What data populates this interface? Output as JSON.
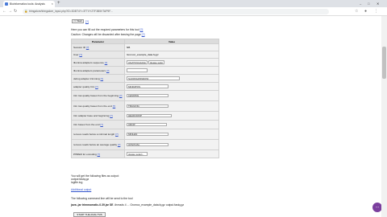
{
  "browser": {
    "tab_title": "Bioinformatics tools: Analysis",
    "url": "trimgalore/trimgalore_input.php?ID=3DBT4Y=3TTXYZ7F3B5VTAP9F...",
    "window_buttons": [
      "–",
      "□",
      "✕"
    ]
  },
  "page": {
    "start_button": "<< Start",
    "intro": "Here you can fill out the required parameters for this tool",
    "caution": "Caution: Changes will be discarded after leaving the page",
    "help_mark": "[?]",
    "table_headers": [
      "Parameter",
      "Value"
    ],
    "rows": [
      {
        "name": "Session ID",
        "value": "NB",
        "kind": "text"
      },
      {
        "name": "User",
        "value": "Gromoz_example_data.fq.gz",
        "kind": "text"
      },
      {
        "name": "Illumina adapters sequence",
        "value": "AGATCGGAAGAGC",
        "value2": "please select...",
        "kind": "input"
      },
      {
        "name": "Illumina adapters parameters",
        "value": "",
        "kind": "input"
      },
      {
        "name": "debug adapter trimming",
        "value": "SLIDINGWINDOW",
        "kind": "input"
      },
      {
        "name": "adapter quality trim",
        "value": "MINIMPOS",
        "kind": "input"
      },
      {
        "name": "trim low quality bases from the beginning",
        "value": "LEADING",
        "kind": "input"
      },
      {
        "name": "trim low quality bases from the end",
        "value": "TRAILING",
        "kind": "input"
      },
      {
        "name": "trim adapter base and beginning",
        "value": "HEADCROP",
        "kind": "input"
      },
      {
        "name": "trim bases from the end",
        "value": "CROP",
        "kind": "input"
      },
      {
        "name": "remove reads below a minimal length",
        "value": "MINLEN",
        "kind": "input"
      },
      {
        "name": "remove reads below an average quality",
        "value": "AVGQUAL",
        "kind": "input"
      },
      {
        "name": "PHRED for encoding",
        "value": "please select...",
        "kind": "input"
      }
    ],
    "outputs_intro": "You will get the following files as output:",
    "outputs": [
      "output fastq.gz",
      "logfile.log"
    ],
    "more_output": "Additional output",
    "running_note": "The following command line will be send to the tool",
    "command_label": "java -jar trimmomatic-0.39.jar SE",
    "command_rest": "-threads 4 ... Gromoz_example_data.fq.gz output.fastq.gz",
    "run_button": "START THE ANALYSIS"
  },
  "fab_label": "⋯"
}
